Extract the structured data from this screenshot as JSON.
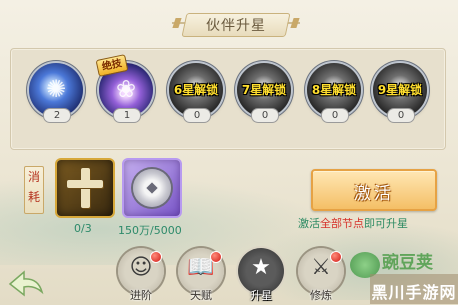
{
  "title": "伙伴升星",
  "nodes": [
    {
      "state": "active",
      "count": "2",
      "icon_name": "blue-swirl-skill-icon"
    },
    {
      "state": "active",
      "count": "1",
      "badge": "绝技",
      "icon_name": "purple-flower-skill-icon"
    },
    {
      "state": "locked",
      "count": "0",
      "lock_text": "6星解锁",
      "icon_name": "locked-skill-icon"
    },
    {
      "state": "locked",
      "count": "0",
      "lock_text": "7星解锁",
      "icon_name": "locked-skill-icon"
    },
    {
      "state": "locked",
      "count": "0",
      "lock_text": "8星解锁",
      "icon_name": "locked-skill-icon"
    },
    {
      "state": "locked",
      "count": "0",
      "lock_text": "9星解锁",
      "icon_name": "locked-skill-icon"
    }
  ],
  "consume": {
    "label": "消耗",
    "items": [
      {
        "icon_name": "gold-cross-token-icon",
        "amount": "0/3"
      },
      {
        "icon_name": "silver-coin-icon",
        "amount": "150万/5000"
      }
    ]
  },
  "activate_button": "激活",
  "hint": {
    "part1": "激活",
    "part2": "全部节点",
    "part3": "即可升星"
  },
  "tabs": [
    {
      "label": "进阶",
      "icon_name": "warrior-portrait-icon",
      "has_dot": true,
      "selected": false
    },
    {
      "label": "天赋",
      "icon_name": "book-icon",
      "has_dot": true,
      "selected": false
    },
    {
      "label": "升星",
      "icon_name": "stars-icon",
      "has_dot": false,
      "selected": true
    },
    {
      "label": "修炼",
      "icon_name": "sword-icon",
      "has_dot": true,
      "selected": false
    }
  ],
  "watermark": {
    "brand": "豌豆荚",
    "site": "黑川手游网"
  },
  "colors": {
    "lock_text": "#ffde2e",
    "hint_green": "#2c8a62",
    "hint_red": "#d6322a",
    "button": "#f4bf66"
  }
}
